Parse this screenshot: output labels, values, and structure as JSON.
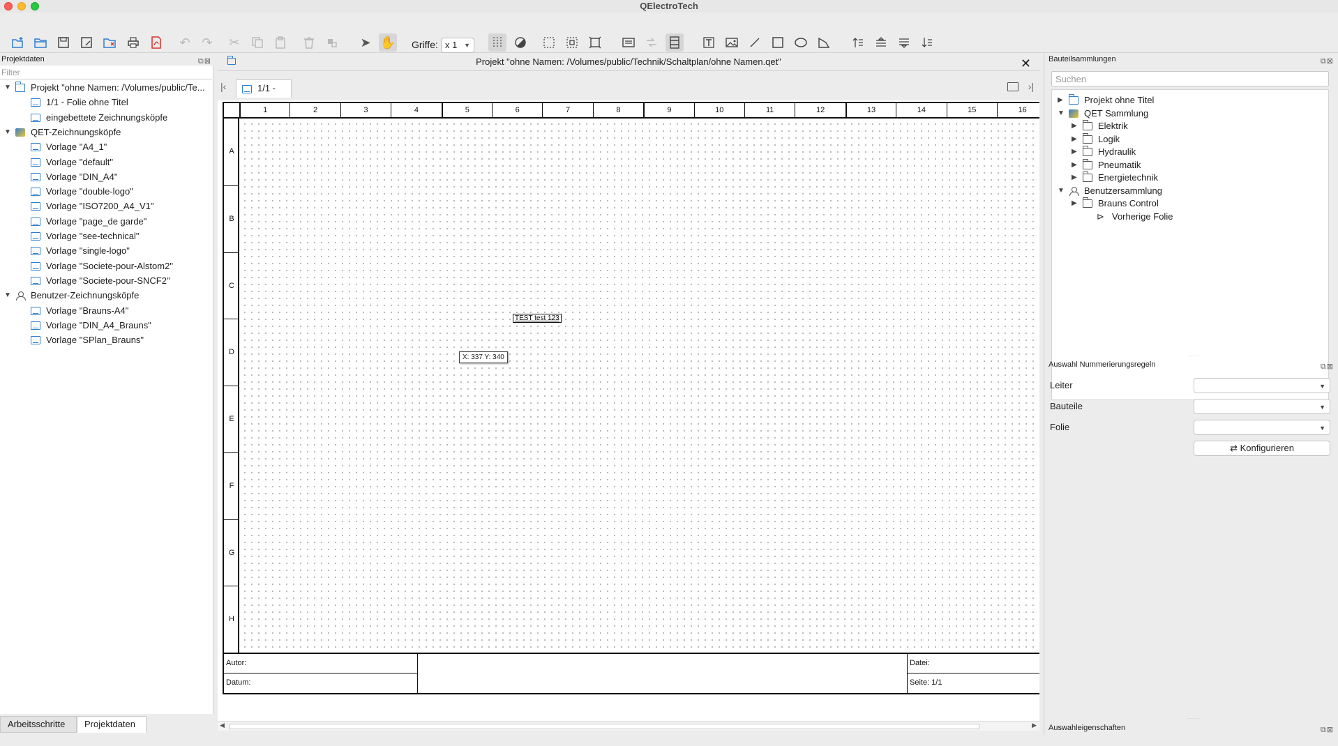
{
  "window": {
    "title": "QElectroTech"
  },
  "toolbar": {
    "griffe_label": "Griffe:",
    "griffe_value": "x 1"
  },
  "left_panel": {
    "title": "Projektdaten",
    "filter_placeholder": "Filter",
    "tree": [
      {
        "label": "Projekt \"ohne Namen: /Volumes/public/Te...",
        "level": 0,
        "icon": "folder-blue-icon",
        "expanded": true
      },
      {
        "label": "1/1 - Folie ohne Titel",
        "level": 1,
        "icon": "sheet-icon"
      },
      {
        "label": "eingebettete Zeichnungsköpfe",
        "level": 1,
        "icon": "sheet-icon"
      },
      {
        "label": "QET-Zeichnungsköpfe",
        "level": 0,
        "icon": "qet-icon",
        "expanded": true
      },
      {
        "label": "Vorlage \"A4_1\"",
        "level": 1,
        "icon": "sheet-icon"
      },
      {
        "label": "Vorlage \"default\"",
        "level": 1,
        "icon": "sheet-icon"
      },
      {
        "label": "Vorlage \"DIN_A4\"",
        "level": 1,
        "icon": "sheet-icon"
      },
      {
        "label": "Vorlage \"double-logo\"",
        "level": 1,
        "icon": "sheet-icon"
      },
      {
        "label": "Vorlage \"ISO7200_A4_V1\"",
        "level": 1,
        "icon": "sheet-icon"
      },
      {
        "label": "Vorlage \"page_de garde\"",
        "level": 1,
        "icon": "sheet-icon"
      },
      {
        "label": "Vorlage \"see-technical\"",
        "level": 1,
        "icon": "sheet-icon"
      },
      {
        "label": "Vorlage \"single-logo\"",
        "level": 1,
        "icon": "sheet-icon"
      },
      {
        "label": "Vorlage \"Societe-pour-Alstom2\"",
        "level": 1,
        "icon": "sheet-icon"
      },
      {
        "label": "Vorlage \"Societe-pour-SNCF2\"",
        "level": 1,
        "icon": "sheet-icon"
      },
      {
        "label": "Benutzer-Zeichnungsköpfe",
        "level": 0,
        "icon": "user-icon",
        "expanded": true
      },
      {
        "label": "Vorlage \"Brauns-A4\"",
        "level": 1,
        "icon": "sheet-icon"
      },
      {
        "label": "Vorlage \"DIN_A4_Brauns\"",
        "level": 1,
        "icon": "sheet-icon"
      },
      {
        "label": "Vorlage \"SPlan_Brauns\"",
        "level": 1,
        "icon": "sheet-icon"
      }
    ],
    "tabs": [
      {
        "label": "Arbeitsschritte",
        "active": false
      },
      {
        "label": "Projektdaten",
        "active": true
      }
    ]
  },
  "center": {
    "project_title": "Projekt \"ohne Namen: /Volumes/public/Technik/Schaltplan/ohne Namen.qet\"",
    "sheet_tab": "1/1 -",
    "columns": [
      "1",
      "2",
      "3",
      "4",
      "5",
      "6",
      "7",
      "8",
      "9",
      "10",
      "11",
      "12",
      "13",
      "14",
      "15",
      "16"
    ],
    "rows": [
      "A",
      "B",
      "C",
      "D",
      "E",
      "F",
      "G",
      "H"
    ],
    "canvas_text": "TEST test 123",
    "coords": "X: 337 Y: 340",
    "cartouche": {
      "author": "Autor:",
      "date": "Datum:",
      "file": "Datei:",
      "page": "Seite: 1/1"
    }
  },
  "right_panel": {
    "title": "Bauteilsammlungen",
    "search_placeholder": "Suchen",
    "tree": [
      {
        "label": "Projekt ohne Titel",
        "level": 0,
        "icon": "folder-blue-icon",
        "expanded": false
      },
      {
        "label": "QET Sammlung",
        "level": 0,
        "icon": "qet-icon",
        "expanded": true
      },
      {
        "label": "Elektrik",
        "level": 1,
        "icon": "folder-icon",
        "expanded": false
      },
      {
        "label": "Logik",
        "level": 1,
        "icon": "folder-icon",
        "expanded": false
      },
      {
        "label": "Hydraulik",
        "level": 1,
        "icon": "folder-icon",
        "expanded": false
      },
      {
        "label": "Pneumatik",
        "level": 1,
        "icon": "folder-icon",
        "expanded": false
      },
      {
        "label": "Energietechnik",
        "level": 1,
        "icon": "folder-icon",
        "expanded": false
      },
      {
        "label": "Benutzersammlung",
        "level": 0,
        "icon": "user-icon",
        "expanded": true
      },
      {
        "label": "Brauns Control",
        "level": 1,
        "icon": "folder-icon",
        "expanded": false
      },
      {
        "label": "Vorherige Folie",
        "level": 2,
        "icon": "arrow-icon"
      }
    ],
    "numbering": {
      "title": "Auswahl Nummerierungsregeln",
      "conductor_label": "Leiter",
      "components_label": "Bauteile",
      "sheet_label": "Folie",
      "configure_label": "Konfigurieren"
    },
    "properties_title": "Auswahleigenschaften"
  }
}
